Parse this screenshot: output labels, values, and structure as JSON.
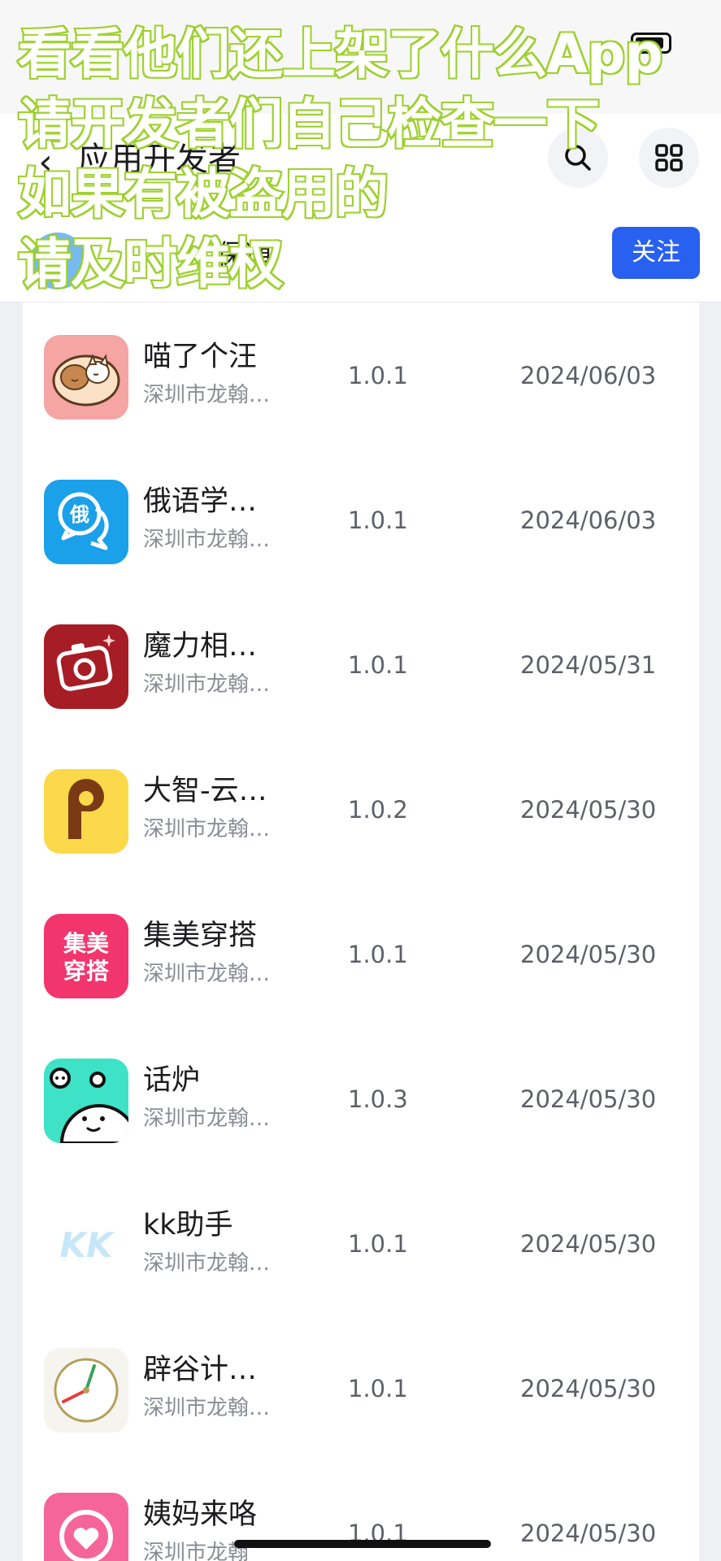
{
  "header": {
    "title": "应用开发者",
    "developer_name": "保通",
    "follow_label": "关注"
  },
  "caption": {
    "lines": [
      "看看他们还上架了什么App",
      "请开发者们自己检查一下",
      "如果有被盗用的",
      "请及时维权"
    ],
    "color": "#ffffff",
    "outline_color": "#97cc28"
  },
  "apps": [
    {
      "name": "喵了个汪",
      "developer": "深圳市龙翰…",
      "version": "1.0.1",
      "date": "2024/06/03",
      "icon": "cat-dog-icon"
    },
    {
      "name": "俄语学…",
      "developer": "深圳市龙翰…",
      "version": "1.0.1",
      "date": "2024/06/03",
      "icon": "russian-chat-icon"
    },
    {
      "name": "魔力相…",
      "developer": "深圳市龙翰…",
      "version": "1.0.1",
      "date": "2024/05/31",
      "icon": "camera-icon"
    },
    {
      "name": "大智-云…",
      "developer": "深圳市龙翰…",
      "version": "1.0.2",
      "date": "2024/05/30",
      "icon": "letter-p-icon"
    },
    {
      "name": "集美穿搭",
      "developer": "深圳市龙翰…",
      "version": "1.0.1",
      "date": "2024/05/30",
      "icon": "jimei-outfit-icon",
      "icon_text": [
        "集美",
        "穿搭"
      ]
    },
    {
      "name": "话炉",
      "developer": "深圳市龙翰…",
      "version": "1.0.3",
      "date": "2024/05/30",
      "icon": "smiley-face-icon"
    },
    {
      "name": "kk助手",
      "developer": "深圳市龙翰…",
      "version": "1.0.1",
      "date": "2024/05/30",
      "icon": "kk-logo-icon",
      "icon_text": [
        "KK"
      ]
    },
    {
      "name": "辟谷计…",
      "developer": "深圳市龙翰…",
      "version": "1.0.1",
      "date": "2024/05/30",
      "icon": "clock-fork-icon"
    },
    {
      "name": "姨妈来咯",
      "developer": "深圳市龙翰",
      "version": "1.0.1",
      "date": "2024/05/30",
      "icon": "heart-moon-icon"
    }
  ]
}
